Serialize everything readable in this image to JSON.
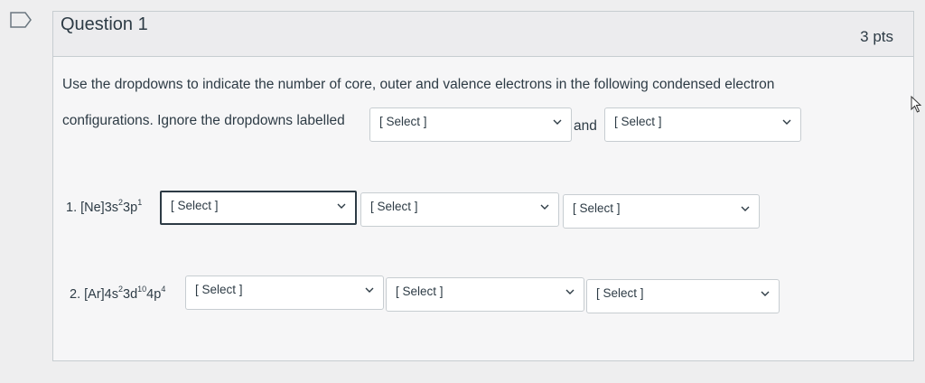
{
  "question": {
    "title": "Question 1",
    "points": "3 pts",
    "instruction_line1": "Use the dropdowns to indicate the number of core, outer and valence electrons in the following condensed electron",
    "instruction_line2": "configurations.  Ignore the dropdowns labelled",
    "and_word": "and"
  },
  "ignore_selects": [
    {
      "value": "[ Select ]"
    },
    {
      "value": "[ Select ]"
    }
  ],
  "items": [
    {
      "prefix": "1. [Ne]3s",
      "sup1": "2",
      "mid": "3p",
      "sup2": "1",
      "selects": [
        {
          "value": "[ Select ]"
        },
        {
          "value": "[ Select ]"
        },
        {
          "value": "[ Select ]"
        }
      ]
    },
    {
      "prefix": "2. [Ar]4s",
      "sup1": "2",
      "mid": "3d",
      "sup2": "10",
      "mid2": "4p",
      "sup3": "4",
      "selects": [
        {
          "value": "[ Select ]"
        },
        {
          "value": "[ Select ]"
        },
        {
          "value": "[ Select ]"
        }
      ]
    }
  ],
  "icons": {
    "bookmark": "bookmark-icon",
    "chevron": "chevron-down-icon",
    "cursor": "mouse-cursor-icon"
  }
}
